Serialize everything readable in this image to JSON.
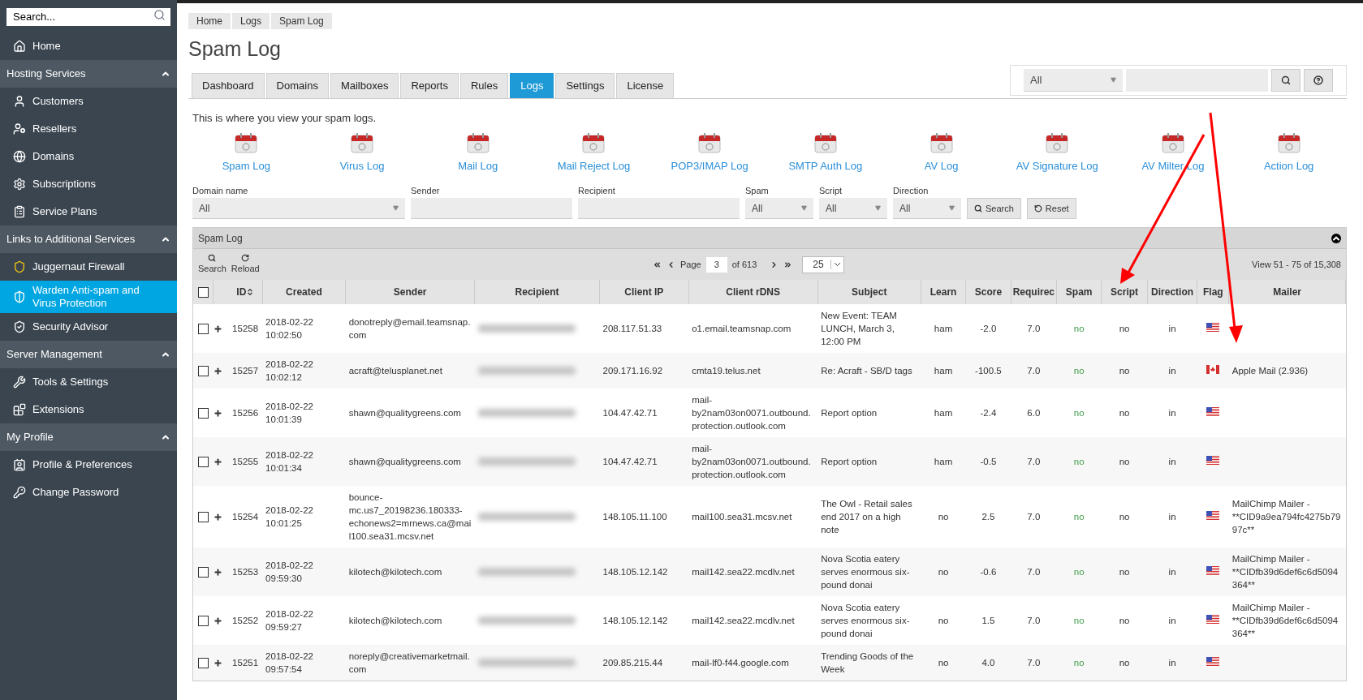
{
  "sidebar": {
    "search": {
      "placeholder": "Search..."
    },
    "sections": [
      {
        "items": [
          {
            "label": "Home",
            "selected": false
          }
        ]
      },
      {
        "title": "Hosting Services",
        "expanded": true,
        "items": [
          {
            "label": "Customers",
            "selected": false
          },
          {
            "label": "Resellers",
            "selected": false
          },
          {
            "label": "Domains",
            "selected": false
          },
          {
            "label": "Subscriptions",
            "selected": false
          },
          {
            "label": "Service Plans",
            "selected": false
          }
        ]
      },
      {
        "title": "Links to Additional Services",
        "expanded": true,
        "items": [
          {
            "label": "Juggernaut Firewall",
            "selected": false
          },
          {
            "label": "Warden Anti-spam and Virus Protection",
            "selected": true
          },
          {
            "label": "Security Advisor",
            "selected": false
          }
        ]
      },
      {
        "title": "Server Management",
        "expanded": true,
        "items": [
          {
            "label": "Tools & Settings",
            "selected": false
          },
          {
            "label": "Extensions",
            "selected": false
          }
        ]
      },
      {
        "title": "My Profile",
        "expanded": true,
        "items": [
          {
            "label": "Profile & Preferences",
            "selected": false
          },
          {
            "label": "Change Password",
            "selected": false
          }
        ]
      }
    ]
  },
  "breadcrumbs": [
    "Home",
    "Logs",
    "Spam Log"
  ],
  "page_title": "Spam Log",
  "top_search": {
    "scope": "All"
  },
  "tabs": [
    {
      "label": "Dashboard",
      "selected": false
    },
    {
      "label": "Domains",
      "selected": false
    },
    {
      "label": "Mailboxes",
      "selected": false
    },
    {
      "label": "Reports",
      "selected": false
    },
    {
      "label": "Rules",
      "selected": false
    },
    {
      "label": "Logs",
      "selected": true
    },
    {
      "label": "Settings",
      "selected": false
    },
    {
      "label": "License",
      "selected": false
    }
  ],
  "intro": "This is where you view your spam logs.",
  "log_links": [
    "Spam Log",
    "Virus Log",
    "Mail Log",
    "Mail Reject Log",
    "POP3/IMAP Log",
    "SMTP Auth Log",
    "AV Log",
    "AV Signature Log",
    "AV Milter Log",
    "Action Log"
  ],
  "filters": [
    {
      "label": "Domain name",
      "kind": "select",
      "value": "All"
    },
    {
      "label": "Sender",
      "kind": "text"
    },
    {
      "label": "Recipient",
      "kind": "text"
    },
    {
      "label": "Spam",
      "kind": "select",
      "value": "All"
    },
    {
      "label": "Script",
      "kind": "select",
      "value": "All"
    },
    {
      "label": "Direction",
      "kind": "select",
      "value": "All"
    }
  ],
  "filter_buttons": [
    "Search",
    "Reset"
  ],
  "panel": {
    "title": "Spam Log",
    "toolbar": [
      "Search",
      "Reload"
    ],
    "page_label": "Page",
    "page": "3",
    "page_of": "of 613",
    "page_size": "25",
    "view_range": "View 51 - 75 of 15,308"
  },
  "table": {
    "columns": [
      "ID",
      "Created",
      "Sender",
      "Recipient",
      "Client IP",
      "Client rDNS",
      "Subject",
      "Learn",
      "Score",
      "Requirec",
      "Spam",
      "Script",
      "Direction",
      "Flag",
      "Mailer"
    ],
    "select_all": {
      "checked": false
    },
    "rows": [
      {
        "checked": false,
        "id": "15258",
        "created": "2018-02-22 10:02:50",
        "sender": "donotreply@email.teamsnap.com",
        "client_ip": "208.117.51.33",
        "rdns": "o1.email.teamsnap.com",
        "subject": "New Event: TEAM LUNCH, March 3, 12:00 PM",
        "learn": "ham",
        "score": "-2.0",
        "required": "7.0",
        "spam": "no",
        "script": "no",
        "direction": "in",
        "flag": {
          "kind": "us"
        }
      },
      {
        "checked": false,
        "id": "15257",
        "created": "2018-02-22 10:02:12",
        "sender": "acraft@telusplanet.net",
        "client_ip": "209.171.16.92",
        "rdns": "cmta19.telus.net",
        "subject": "Re: Acraft - SB/D tags",
        "learn": "ham",
        "score": "-100.5",
        "required": "7.0",
        "spam": "no",
        "script": "no",
        "direction": "in",
        "flag": {
          "kind": "ca"
        },
        "mailer": "Apple Mail (2.936)"
      },
      {
        "checked": false,
        "id": "15256",
        "created": "2018-02-22 10:01:39",
        "sender": "shawn@qualitygreens.com",
        "client_ip": "104.47.42.71",
        "rdns": "mail-by2nam03on0071.outbound.protection.outlook.com",
        "subject": "Report option",
        "learn": "ham",
        "score": "-2.4",
        "required": "6.0",
        "spam": "no",
        "script": "no",
        "direction": "in",
        "flag": {
          "kind": "us"
        }
      },
      {
        "checked": false,
        "id": "15255",
        "created": "2018-02-22 10:01:34",
        "sender": "shawn@qualitygreens.com",
        "client_ip": "104.47.42.71",
        "rdns": "mail-by2nam03on0071.outbound.protection.outlook.com",
        "subject": "Report option",
        "learn": "ham",
        "score": "-0.5",
        "required": "7.0",
        "spam": "no",
        "script": "no",
        "direction": "in",
        "flag": {
          "kind": "us"
        }
      },
      {
        "checked": false,
        "id": "15254",
        "created": "2018-02-22 10:01:25",
        "sender": "bounce-mc.us7_20198236.180333-echonews2=mrnews.ca@mail100.sea31.mcsv.net",
        "client_ip": "148.105.11.100",
        "rdns": "mail100.sea31.mcsv.net",
        "subject": "The Owl - Retail sales end 2017 on a high note",
        "learn": "no",
        "score": "2.5",
        "required": "7.0",
        "spam": "no",
        "script": "no",
        "direction": "in",
        "flag": {
          "kind": "us"
        },
        "mailer": "MailChimp Mailer - **CID9a9ea794fc4275b7997c**"
      },
      {
        "checked": false,
        "id": "15253",
        "created": "2018-02-22 09:59:30",
        "sender": "kilotech@kilotech.com",
        "client_ip": "148.105.12.142",
        "rdns": "mail142.sea22.mcdlv.net",
        "subject": "Nova Scotia eatery serves enormous six-pound donai",
        "learn": "no",
        "score": "-0.6",
        "required": "7.0",
        "spam": "no",
        "script": "no",
        "direction": "in",
        "flag": {
          "kind": "us"
        },
        "mailer": "MailChimp Mailer - **CIDfb39d6def6c6d5094364**"
      },
      {
        "checked": false,
        "id": "15252",
        "created": "2018-02-22 09:59:27",
        "sender": "kilotech@kilotech.com",
        "client_ip": "148.105.12.142",
        "rdns": "mail142.sea22.mcdlv.net",
        "subject": "Nova Scotia eatery serves enormous six-pound donai",
        "learn": "no",
        "score": "1.5",
        "required": "7.0",
        "spam": "no",
        "script": "no",
        "direction": "in",
        "flag": {
          "kind": "us"
        },
        "mailer": "MailChimp Mailer - **CIDfb39d6def6c6d5094364**"
      },
      {
        "checked": false,
        "id": "15251",
        "created": "2018-02-22 09:57:54",
        "sender": "noreply@creativemarketmail.com",
        "client_ip": "209.85.215.44",
        "rdns": "mail-lf0-f44.google.com",
        "subject": "Trending Goods of the Week",
        "learn": "no",
        "score": "4.0",
        "required": "7.0",
        "spam": "no",
        "script": "no",
        "direction": "in",
        "flag": {
          "kind": "us"
        }
      }
    ]
  }
}
